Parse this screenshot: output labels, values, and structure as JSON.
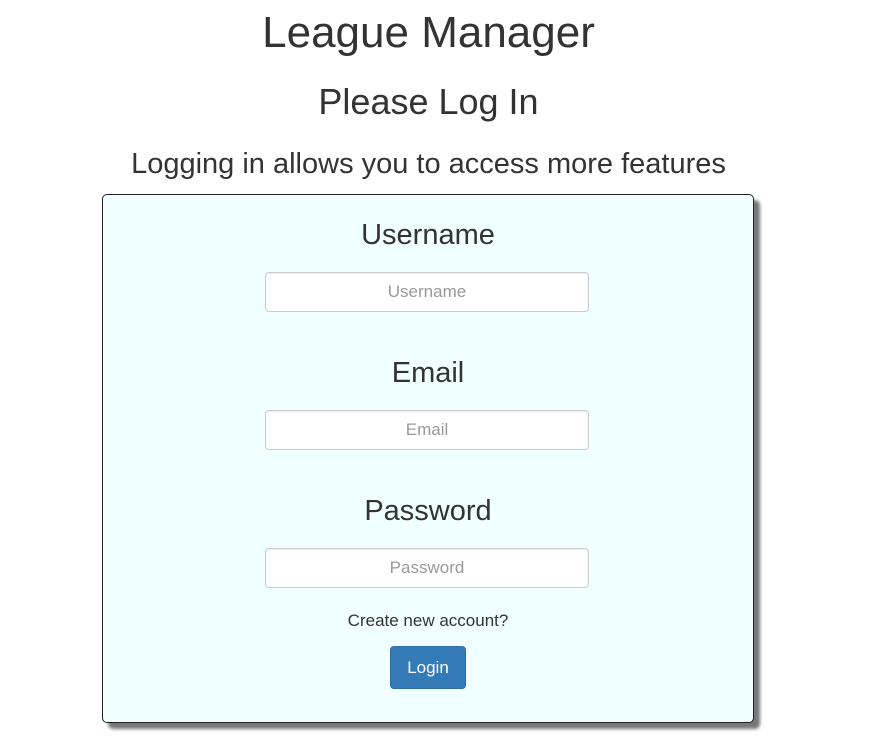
{
  "header": {
    "app_title": "League Manager",
    "page_heading": "Please Log In",
    "subheading": "Logging in allows you to access more features"
  },
  "login_form": {
    "username": {
      "label": "Username",
      "placeholder": "Username",
      "value": ""
    },
    "email": {
      "label": "Email",
      "placeholder": "Email",
      "value": ""
    },
    "password": {
      "label": "Password",
      "placeholder": "Password",
      "value": ""
    },
    "create_account_link": "Create new account?",
    "login_button_label": "Login"
  },
  "colors": {
    "panel_background": "#f0ffff",
    "primary_button": "#337ab7",
    "text": "#333333"
  }
}
